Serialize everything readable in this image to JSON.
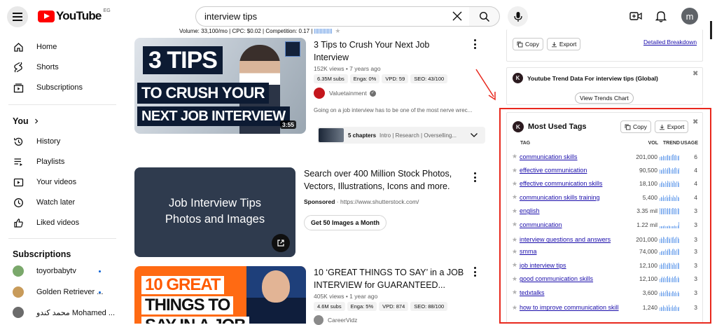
{
  "header": {
    "logo_text": "YouTube",
    "country_code": "EG",
    "search_value": "interview tips",
    "avatar_letter": "m",
    "keyword_stats": "Volume: 33,100/mo | CPC: $0.02 | Competition: 0.17 |"
  },
  "sidebar": {
    "items": [
      {
        "label": "Home",
        "icon": "home-icon"
      },
      {
        "label": "Shorts",
        "icon": "shorts-icon"
      },
      {
        "label": "Subscriptions",
        "icon": "subscriptions-icon"
      }
    ],
    "you_label": "You",
    "you_items": [
      {
        "label": "History",
        "icon": "history-icon"
      },
      {
        "label": "Playlists",
        "icon": "playlists-icon"
      },
      {
        "label": "Your videos",
        "icon": "your-videos-icon"
      },
      {
        "label": "Watch later",
        "icon": "watch-later-icon"
      },
      {
        "label": "Liked videos",
        "icon": "liked-videos-icon"
      }
    ],
    "subscriptions_label": "Subscriptions",
    "subscriptions": [
      {
        "name": "toyorbabytv",
        "color": "#7aa86b"
      },
      {
        "name": "Golden Retriever ...",
        "color": "#c89b5a"
      },
      {
        "name": "محمد كندو Mohamed ...",
        "color": "#6b6b6b"
      }
    ]
  },
  "videos": [
    {
      "thumb_lines": [
        "3 TIPS",
        "TO CRUSH YOUR",
        "NEXT JOB INTERVIEW"
      ],
      "duration": "3:55",
      "title_line1": "3 Tips to Crush Your Next Job",
      "title_line2": "Interview",
      "views_age": "152K views • 7 years ago",
      "chips": [
        "6.35M subs",
        "Enga: 0%",
        "VPD: 59",
        "SEO: 43/100"
      ],
      "channel": "Valuetainment",
      "snippet": "Going on a job interview has to be one of the most nerve wrec...",
      "chapters_bold": "5 chapters",
      "chapters_text": "Intro | Research | Overselling..."
    },
    {
      "thumb_line1": "Job Interview Tips",
      "thumb_line2": "Photos and Images",
      "title_line1": "Search over 400 Million Stock Photos,",
      "title_line2": "Vectors, Illustrations, Icons and more.",
      "sponsored": "Sponsored",
      "url": "https://www.shutterstock.com/",
      "cta": "Get 50 Images a Month"
    },
    {
      "thumb_lines": [
        "10 GREAT",
        "THINGS TO",
        "SAY IN A JOB"
      ],
      "title_line1": "10 ‘GREAT THINGS TO SAY’ in a JOB",
      "title_line2": "INTERVIEW for GUARANTEED...",
      "views_age": "405K views • 1 year ago",
      "chips": [
        "4.6M subs",
        "Enga: 5%",
        "VPD: 874",
        "SEO: 88/100"
      ],
      "channel": "CareerVidz"
    }
  ],
  "panel_top": {
    "copy": "Copy",
    "export": "Export",
    "detailed": "Detailed Breakdown"
  },
  "trend_panel": {
    "title": "Youtube Trend Data For interview tips (Global)",
    "button": "View Trends Chart"
  },
  "tags_panel": {
    "title": "Most Used Tags",
    "copy": "Copy",
    "export": "Export",
    "col_tag": "TAG",
    "col_vol": "VOL",
    "col_trend": "TREND",
    "col_usage": "USAGE",
    "rows": [
      {
        "tag": "communication skills",
        "vol": "201,000",
        "usage": "6",
        "trend": [
          4,
          5,
          4,
          6,
          5,
          5,
          6,
          7,
          6,
          5,
          6,
          7,
          8,
          6,
          7,
          6,
          5,
          6
        ]
      },
      {
        "tag": "effective communication",
        "vol": "90,500",
        "usage": "4",
        "trend": [
          5,
          4,
          5,
          6,
          5,
          6,
          5,
          6,
          7,
          6,
          5,
          6,
          5,
          6,
          7,
          6,
          5,
          6
        ]
      },
      {
        "tag": "effective communication skills",
        "vol": "18,100",
        "usage": "4",
        "trend": [
          4,
          5,
          6,
          5,
          4,
          6,
          5,
          7,
          6,
          5,
          6,
          5,
          7,
          6,
          5,
          6,
          6,
          5
        ]
      },
      {
        "tag": "communication skills training",
        "vol": "5,400",
        "usage": "4",
        "trend": [
          3,
          5,
          4,
          6,
          4,
          5,
          6,
          4,
          5,
          7,
          5,
          4,
          6,
          5,
          4,
          6,
          5,
          4
        ]
      },
      {
        "tag": "english",
        "vol": "3.35 mil",
        "usage": "3",
        "trend": [
          6,
          5,
          6,
          5,
          6,
          6,
          5,
          6,
          5,
          6,
          5,
          6,
          6,
          5,
          6,
          5,
          6,
          5
        ]
      },
      {
        "tag": "communication",
        "vol": "1.22 mil",
        "usage": "3",
        "trend": [
          2,
          2,
          2,
          2,
          3,
          2,
          2,
          2,
          3,
          2,
          2,
          2,
          2,
          3,
          2,
          2,
          3,
          7
        ]
      },
      {
        "tag": "interview questions and answers",
        "vol": "201,000",
        "usage": "3",
        "trend": [
          5,
          6,
          5,
          7,
          6,
          5,
          6,
          7,
          6,
          5,
          6,
          6,
          7,
          5,
          6,
          7,
          6,
          5
        ]
      },
      {
        "tag": "smma",
        "vol": "74,000",
        "usage": "3",
        "trend": [
          3,
          4,
          5,
          4,
          5,
          6,
          5,
          6,
          7,
          6,
          5,
          6,
          7,
          6,
          5,
          6,
          7,
          6
        ]
      },
      {
        "tag": "job interview tips",
        "vol": "12,100",
        "usage": "3",
        "trend": [
          5,
          6,
          5,
          6,
          7,
          6,
          5,
          6,
          7,
          6,
          6,
          5,
          7,
          6,
          5,
          6,
          7,
          6
        ]
      },
      {
        "tag": "good communication skills",
        "vol": "12,100",
        "usage": "3",
        "trend": [
          4,
          5,
          6,
          5,
          6,
          5,
          6,
          7,
          5,
          6,
          5,
          6,
          5,
          6,
          7,
          5,
          6,
          5
        ]
      },
      {
        "tag": "tedxtalks",
        "vol": "3,600",
        "usage": "3",
        "trend": [
          2,
          3,
          2,
          3,
          2,
          3,
          4,
          3,
          2,
          3,
          2,
          3,
          3,
          2,
          3,
          2,
          3,
          2
        ]
      },
      {
        "tag": "how to improve communication skill",
        "vol": "1,240",
        "usage": "3",
        "trend": [
          4,
          5,
          4,
          6,
          5,
          4,
          6,
          5,
          7,
          4,
          5,
          6,
          4,
          5,
          6,
          5,
          4,
          5
        ]
      }
    ]
  },
  "colors": {
    "youtube_red": "#ff0000",
    "annotation_red": "#e8281d",
    "link_blue": "#1a0dab",
    "trend_blue": "#8ab4f0"
  }
}
